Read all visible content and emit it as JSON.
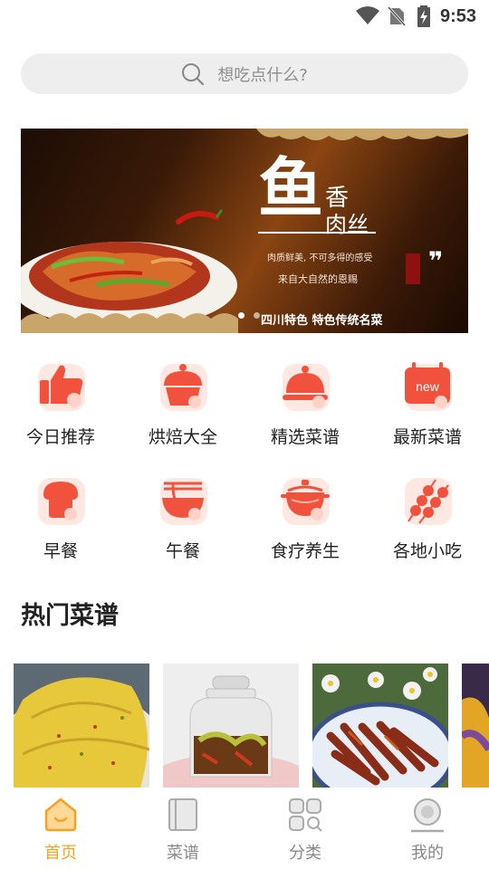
{
  "status_bar": {
    "time": "9:53",
    "icons": [
      "wifi-icon",
      "no-sim-icon",
      "battery-charging-icon"
    ]
  },
  "search": {
    "placeholder": "想吃点什么?"
  },
  "banner": {
    "title_main": "鱼",
    "title_small_1": "香",
    "title_small_2": "肉丝",
    "desc_1": "肉质鲜美, 不可多得的感受",
    "desc_2": "来自大自然的恩赐",
    "caption": "四川特色  特色传统名菜",
    "page_count": 2,
    "active_page": 0
  },
  "categories": [
    {
      "label": "今日推荐",
      "icon": "thumbs-up-icon"
    },
    {
      "label": "烘焙大全",
      "icon": "cupcake-icon"
    },
    {
      "label": "精选菜谱",
      "icon": "cloche-icon"
    },
    {
      "label": "最新菜谱",
      "icon": "new-calendar-icon"
    },
    {
      "label": "早餐",
      "icon": "toast-icon"
    },
    {
      "label": "午餐",
      "icon": "noodle-bowl-icon"
    },
    {
      "label": "食疗养生",
      "icon": "pot-icon"
    },
    {
      "label": "各地小吃",
      "icon": "skewer-icon"
    }
  ],
  "hot_recipes": {
    "title": "热门菜谱",
    "items": [
      {
        "image": "egg-pancake-photo"
      },
      {
        "image": "pickled-jar-photo"
      },
      {
        "image": "braised-meat-strips-photo"
      },
      {
        "image": "partial-dish-photo"
      }
    ]
  },
  "bottom_nav": {
    "active": "home",
    "items": [
      {
        "label": "首页",
        "icon": "home-icon"
      },
      {
        "label": "菜谱",
        "icon": "book-icon"
      },
      {
        "label": "分类",
        "icon": "category-icon"
      },
      {
        "label": "我的",
        "icon": "profile-icon"
      }
    ]
  },
  "colors": {
    "accent": "#f5a321",
    "icon_red": "#f0523d",
    "icon_bg": "#ffe7e2",
    "search_bg": "#eeeeee"
  }
}
